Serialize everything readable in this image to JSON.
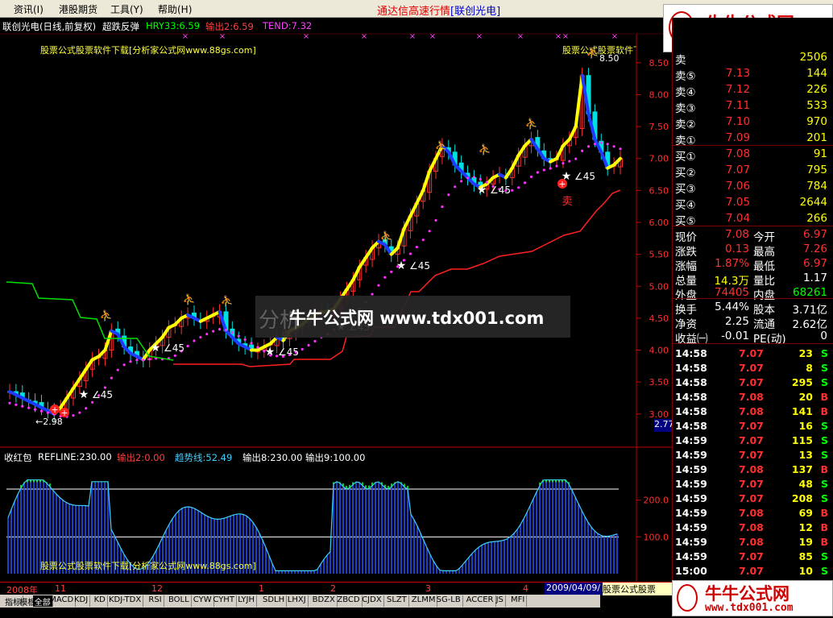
{
  "menu": [
    "资讯(I)",
    "港股期货",
    "工具(Y)",
    "帮助(H)"
  ],
  "app_title": "通达信高速行情",
  "app_stock_tag": "[联创光电]",
  "chart_header": {
    "stock": "联创光电(日线,前复权)",
    "indicator": "超跌反弹",
    "hry": "HRY33:6.59",
    "out2": "输出2:6.59",
    "tend": "TEND:7.32"
  },
  "watermark_text": "股票公式股票软件下载[分析家公式网www.88gs.com]",
  "center_watermark": {
    "left_text": "分析",
    "main_text": "牛牛公式网 www.tdx001.com"
  },
  "logo": {
    "title": "牛牛公式网",
    "url": "www.tdx001.com"
  },
  "colors": {
    "up": "#ff3030",
    "down": "#00e0e0",
    "yellow": "#ffff00",
    "bg": "#000000",
    "axis": "#c00000"
  },
  "price_axis": {
    "ticks": [
      "8.50",
      "8.00",
      "7.50",
      "7.00",
      "6.50",
      "6.00",
      "5.50",
      "5.00",
      "4.50",
      "4.00",
      "3.50",
      "3.00"
    ],
    "current_tag": "2.77"
  },
  "annotations": {
    "high_label": "8.50",
    "low_label": "←2.98",
    "angle_labels": [
      "∠45",
      "∠45",
      "∠45",
      "∠45",
      "∠45",
      "∠45",
      "∠45"
    ],
    "sell_mark": "卖"
  },
  "sub_chart": {
    "title": "收红包",
    "refline": "REFLINE:230.00",
    "out2": "输出2:0.00",
    "trend": "趋势线:52.49",
    "out8": "输出8:230.00",
    "out9": "输出9:100.00",
    "ticks": [
      "200.0",
      "100.0"
    ]
  },
  "date_axis": {
    "labels": [
      "2008年",
      "11",
      "12",
      "1",
      "2",
      "3",
      "4"
    ],
    "current_date": "2009/04/09/",
    "right_watermark": "股票公式股票"
  },
  "tabs": [
    "指标",
    "模板",
    "全部",
    "MACD",
    "KDJ",
    "KD",
    "KDJ-TDX",
    "RSI",
    "BOLL",
    "CYW",
    "CYHT",
    "LYJH",
    "SDLH",
    "LHXJ",
    "BDZX",
    "ZBCD",
    "CJDX",
    "SLZT",
    "ZLMM",
    "SG-LB",
    "ACCER",
    "JS",
    "MFI"
  ],
  "order_book": {
    "top_partial": {
      "label": "卖",
      "price": "",
      "vol": "2506"
    },
    "sells": [
      {
        "label": "卖⑤",
        "price": "7.13",
        "vol": "144"
      },
      {
        "label": "卖④",
        "price": "7.12",
        "vol": "226"
      },
      {
        "label": "卖③",
        "price": "7.11",
        "vol": "533"
      },
      {
        "label": "卖②",
        "price": "7.10",
        "vol": "970"
      },
      {
        "label": "卖①",
        "price": "7.09",
        "vol": "201"
      }
    ],
    "buys": [
      {
        "label": "买①",
        "price": "7.08",
        "vol": "91"
      },
      {
        "label": "买②",
        "price": "7.07",
        "vol": "795"
      },
      {
        "label": "买③",
        "price": "7.06",
        "vol": "784"
      },
      {
        "label": "买④",
        "price": "7.05",
        "vol": "2644"
      },
      {
        "label": "买⑤",
        "price": "7.04",
        "vol": "266"
      }
    ]
  },
  "stats": [
    {
      "l1": "现价",
      "v1": "7.08",
      "l2": "今开",
      "v2": "6.97"
    },
    {
      "l1": "涨跌",
      "v1": "0.13",
      "l2": "最高",
      "v2": "7.26"
    },
    {
      "l1": "涨幅",
      "v1": "1.87%",
      "l2": "最低",
      "v2": "6.97"
    },
    {
      "l1": "总量",
      "v1": "14.3万",
      "l2": "量比",
      "v2": "1.17"
    },
    {
      "l1": "外盘",
      "v1": "74405",
      "l2": "内盘",
      "v2": "68261"
    },
    {
      "l1": "换手",
      "v1": "5.44%",
      "l2": "股本",
      "v2": "3.71亿"
    },
    {
      "l1": "净资",
      "v1": "2.25",
      "l2": "流通",
      "v2": "2.62亿"
    },
    {
      "l1": "收益㈠",
      "v1": "-0.01",
      "l2": "PE(动)",
      "v2": "0"
    }
  ],
  "ticks": [
    {
      "time": "14:58",
      "price": "7.07",
      "vol": "23",
      "side": "S"
    },
    {
      "time": "14:58",
      "price": "7.07",
      "vol": "8",
      "side": "S"
    },
    {
      "time": "14:58",
      "price": "7.07",
      "vol": "295",
      "side": "S"
    },
    {
      "time": "14:58",
      "price": "7.08",
      "vol": "20",
      "side": "B"
    },
    {
      "time": "14:58",
      "price": "7.08",
      "vol": "141",
      "side": "B"
    },
    {
      "time": "14:58",
      "price": "7.07",
      "vol": "16",
      "side": "S"
    },
    {
      "time": "14:59",
      "price": "7.07",
      "vol": "115",
      "side": "S"
    },
    {
      "time": "14:59",
      "price": "7.07",
      "vol": "13",
      "side": "S"
    },
    {
      "time": "14:59",
      "price": "7.08",
      "vol": "137",
      "side": "B"
    },
    {
      "time": "14:59",
      "price": "7.07",
      "vol": "48",
      "side": "S"
    },
    {
      "time": "14:59",
      "price": "7.07",
      "vol": "208",
      "side": "S"
    },
    {
      "time": "14:59",
      "price": "7.08",
      "vol": "69",
      "side": "B"
    },
    {
      "time": "14:59",
      "price": "7.08",
      "vol": "12",
      "side": "B"
    },
    {
      "time": "14:59",
      "price": "7.08",
      "vol": "19",
      "side": "B"
    },
    {
      "time": "14:59",
      "price": "7.07",
      "vol": "85",
      "side": "S"
    },
    {
      "time": "15:00",
      "price": "7.07",
      "vol": "10",
      "side": "S"
    }
  ],
  "chart_data": {
    "type": "line",
    "ylim": [
      2.77,
      8.7
    ],
    "close": [
      3.35,
      3.3,
      3.25,
      3.2,
      3.15,
      3.1,
      3.05,
      3.0,
      3.1,
      3.25,
      3.4,
      3.55,
      3.7,
      3.85,
      3.9,
      4.0,
      4.3,
      4.25,
      4.05,
      3.95,
      3.9,
      3.85,
      4.0,
      4.1,
      4.2,
      4.35,
      4.4,
      4.5,
      4.55,
      4.5,
      4.45,
      4.5,
      4.55,
      4.6,
      4.3,
      4.2,
      4.1,
      4.05,
      4.0,
      4.0,
      4.05,
      4.1,
      4.2,
      4.15,
      4.3,
      4.35,
      4.4,
      4.5,
      4.55,
      4.6,
      4.6,
      4.65,
      4.8,
      4.95,
      5.1,
      5.3,
      5.45,
      5.6,
      5.7,
      5.65,
      5.5,
      5.6,
      5.9,
      6.1,
      6.3,
      6.5,
      6.8,
      7.0,
      7.2,
      7.1,
      6.9,
      6.8,
      6.7,
      6.6,
      6.55,
      6.6,
      6.7,
      6.75,
      6.7,
      6.85,
      7.05,
      7.2,
      7.3,
      7.15,
      7.0,
      6.95,
      7.0,
      7.2,
      7.3,
      7.5,
      8.3,
      7.7,
      7.3,
      7.1,
      6.85,
      6.9,
      7.0
    ]
  }
}
